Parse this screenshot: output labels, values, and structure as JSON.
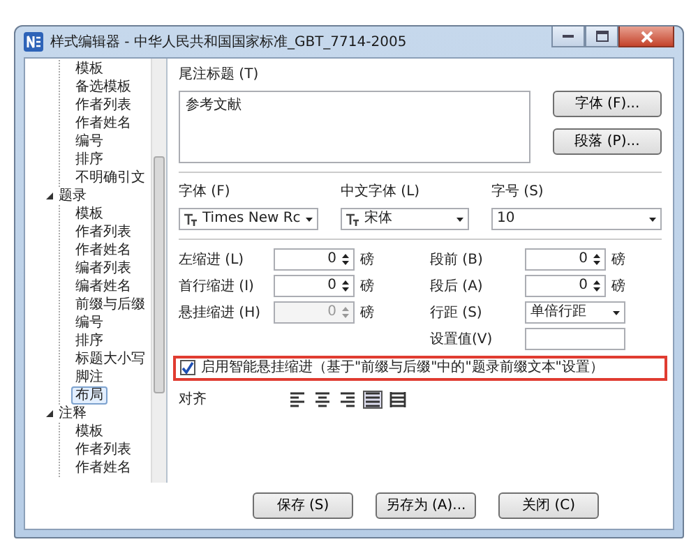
{
  "window": {
    "title": "样式编辑器 - 中华人民共和国国家标准_GBT_7714-2005"
  },
  "tree": {
    "leading_children": [
      {
        "label": "模板",
        "selected": false
      },
      {
        "label": "备选模板",
        "selected": false
      },
      {
        "label": "作者列表",
        "selected": false
      },
      {
        "label": "作者姓名",
        "selected": false
      },
      {
        "label": "编号",
        "selected": false
      },
      {
        "label": "排序",
        "selected": false
      },
      {
        "label": "不明确引文",
        "selected": false
      }
    ],
    "nodes": [
      {
        "label": "题录",
        "expanded": true,
        "selected": false,
        "children": [
          {
            "label": "模板",
            "selected": false
          },
          {
            "label": "作者列表",
            "selected": false
          },
          {
            "label": "作者姓名",
            "selected": false
          },
          {
            "label": "编者列表",
            "selected": false
          },
          {
            "label": "编者姓名",
            "selected": false
          },
          {
            "label": "前缀与后缀",
            "selected": false
          },
          {
            "label": "编号",
            "selected": false
          },
          {
            "label": "排序",
            "selected": false
          },
          {
            "label": "标题大小写",
            "selected": false
          },
          {
            "label": "脚注",
            "selected": false
          },
          {
            "label": "布局",
            "selected": true
          }
        ]
      },
      {
        "label": "注释",
        "expanded": true,
        "selected": false,
        "children": [
          {
            "label": "模板",
            "selected": false
          },
          {
            "label": "作者列表",
            "selected": false
          },
          {
            "label": "作者姓名",
            "selected": false
          }
        ]
      }
    ]
  },
  "heading": {
    "label": "尾注标题 (T)",
    "value": "参考文献",
    "buttons": [
      "字体 (F)...",
      "段落 (P)..."
    ]
  },
  "fonts": [
    {
      "label": "字体 (F)",
      "value": "Times New Rc",
      "kind": "font"
    },
    {
      "label": "中文字体 (L)",
      "value": "宋体",
      "kind": "font"
    },
    {
      "label": "字号 (S)",
      "value": "10",
      "kind": "plain"
    }
  ],
  "spacing": [
    {
      "label": "左缩进 (L)",
      "kind": "spin",
      "value": "0",
      "unit": "磅",
      "disabled": false
    },
    {
      "label": "段前 (B)",
      "kind": "spin",
      "value": "0",
      "unit": "磅",
      "disabled": false
    },
    {
      "label": "首行缩进 (I)",
      "kind": "spin",
      "value": "0",
      "unit": "磅",
      "disabled": false
    },
    {
      "label": "段后 (A)",
      "kind": "spin",
      "value": "0",
      "unit": "磅",
      "disabled": false
    },
    {
      "label": "悬挂缩进 (H)",
      "kind": "spin",
      "value": "0",
      "unit": "磅",
      "disabled": true
    },
    {
      "label": "行距 (S)",
      "kind": "select",
      "value": "单倍行距"
    },
    {
      "kind": "empty"
    },
    {
      "label": "设置值(V)",
      "kind": "text"
    }
  ],
  "smart_indent": {
    "label": "启用智能悬挂缩进（基于\"前缀与后缀\"中的\"题录前缀文本\"设置）",
    "checked": true,
    "highlighted": true
  },
  "alignment": {
    "label": "对齐",
    "options": [
      {
        "kind": "left",
        "selected": false
      },
      {
        "kind": "center",
        "selected": false
      },
      {
        "kind": "right",
        "selected": false
      },
      {
        "kind": "justify",
        "selected": true
      },
      {
        "kind": "distributed",
        "selected": false
      }
    ]
  },
  "buttons": [
    "保存 (S)",
    "另存为 (A)...",
    "关闭 (C)"
  ]
}
